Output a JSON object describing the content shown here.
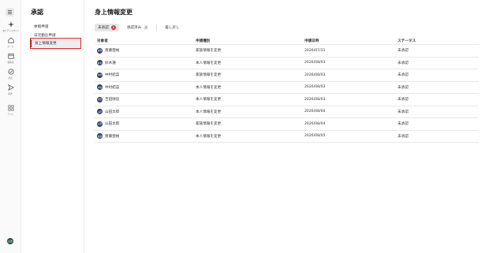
{
  "rail": {
    "items": [
      {
        "label": "あびアシスタント",
        "icon": "sparkle-icon"
      },
      {
        "label": "ホーム",
        "icon": "home-icon"
      },
      {
        "label": "勤務表",
        "icon": "calendar-icon"
      },
      {
        "label": "承認",
        "icon": "check-circle-icon"
      },
      {
        "label": "申請",
        "icon": "send-icon"
      },
      {
        "label": "アプリ",
        "icon": "grid-icon"
      }
    ],
    "avatar": "山田"
  },
  "panel": {
    "title": "承認",
    "items": [
      {
        "label": "休暇申請"
      },
      {
        "label": "日次勤怠申請"
      },
      {
        "label": "身上情報変更"
      }
    ]
  },
  "main": {
    "title": "身上情報変更",
    "tabs": [
      {
        "label": "未承認",
        "count": "8"
      },
      {
        "label": "承認済み",
        "count": "3"
      },
      {
        "label": "差し戻し",
        "count": ""
      }
    ],
    "columns": [
      "対象者",
      "申請種別",
      "申請日時",
      "ステータス"
    ],
    "rows": [
      {
        "avatar": "斎藤",
        "name": "斎藤亜裕",
        "type": "家族情報を変更",
        "date": "2026/07/31",
        "status": "未承認"
      },
      {
        "avatar": "鈴木",
        "name": "鈴木蓮",
        "type": "本人情報を変更",
        "date": "2026/08/03",
        "status": "未承認"
      },
      {
        "avatar": "中村",
        "name": "中村結菜",
        "type": "家族情報を変更",
        "date": "2026/08/03",
        "status": "未承認"
      },
      {
        "avatar": "中村",
        "name": "中村結菜",
        "type": "本人情報を変更",
        "date": "2026/08/03",
        "status": "未承認"
      },
      {
        "avatar": "吉田",
        "name": "吉田咲良",
        "type": "本人情報を変更",
        "date": "2026/08/03",
        "status": "未承認"
      },
      {
        "avatar": "山田",
        "name": "山田太郎",
        "type": "本人情報を変更",
        "date": "2026/08/04",
        "status": "未承認"
      },
      {
        "avatar": "山田",
        "name": "山田太郎",
        "type": "家族情報を変更",
        "date": "2026/08/04",
        "status": "未承認"
      },
      {
        "avatar": "斎藤",
        "name": "斎藤亜裕",
        "type": "本人情報を変更",
        "date": "2026/08/05",
        "status": "未承認"
      }
    ]
  },
  "colors": {
    "accent_badge": "#d9383a",
    "highlight": "#e02020",
    "avatar_bg": "#2d3a6b"
  }
}
